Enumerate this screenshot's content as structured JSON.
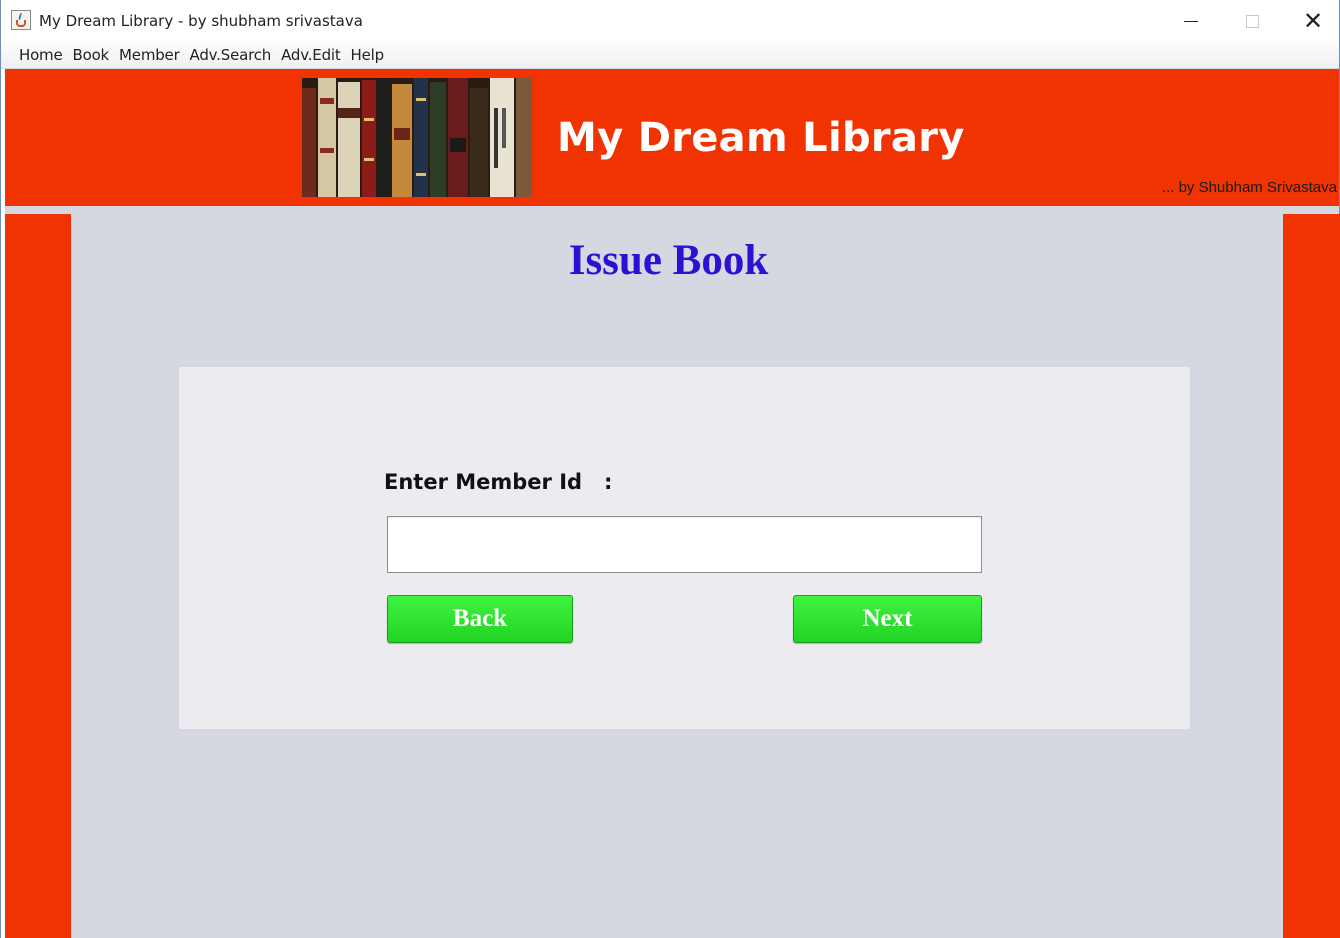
{
  "window": {
    "title": "My Dream Library - by shubham srivastava",
    "controls": [
      "minimize",
      "maximize",
      "close"
    ]
  },
  "menubar": {
    "items": [
      "Home",
      "Book",
      "Member",
      "Adv.Search",
      "Adv.Edit",
      "Help"
    ]
  },
  "header": {
    "title": "My Dream Library",
    "author": "... by Shubham Srivastava"
  },
  "page": {
    "title": "Issue Book",
    "member_label": "Enter Member Id   :",
    "member_value": "",
    "back_label": "Back",
    "next_label": "Next"
  },
  "colors": {
    "accent": "#f03300",
    "title": "#2a12d4",
    "button": "#2ee02e",
    "content_bg": "#d5d8e0",
    "panel_bg": "#ecebf0"
  }
}
